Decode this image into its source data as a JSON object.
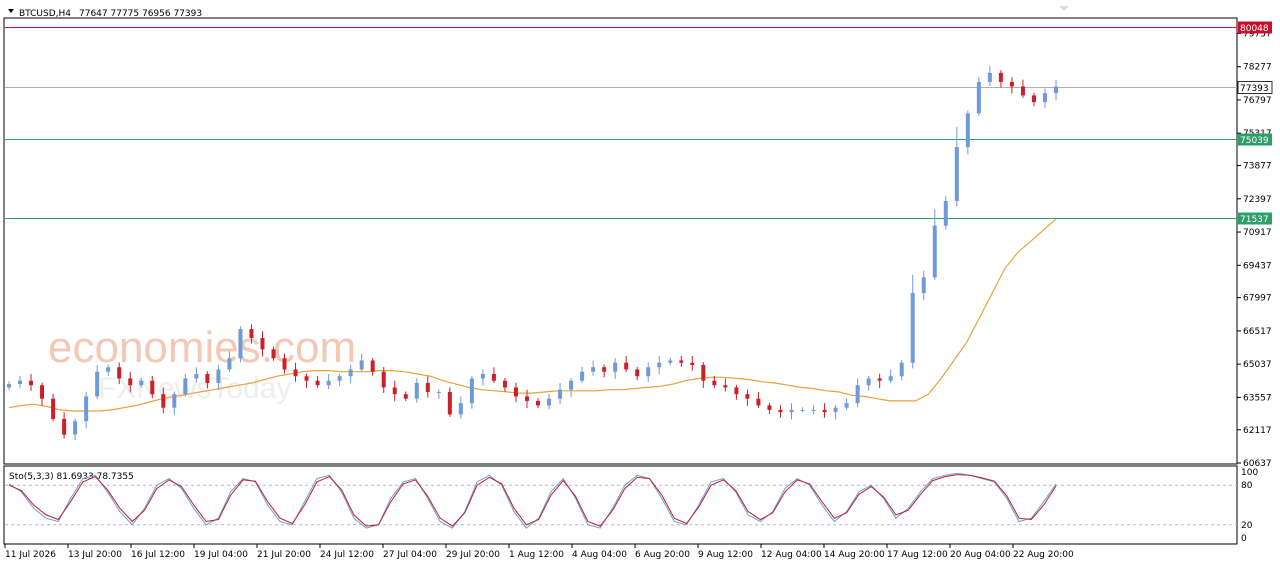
{
  "header": {
    "symbol": "BTCUSD,H4",
    "ohlc": "77647 77775 76956 77393"
  },
  "watermark": {
    "brand": "economies.com",
    "sub": "FXNewsToday"
  },
  "colors": {
    "bull": "#6f9ad8",
    "bear": "#cc1f28",
    "ma": "#e8a23c",
    "stoch_main": "#6ba0d8",
    "stoch_signal": "#c0202c",
    "res_line": "#c8102e",
    "green_line": "#2e9e6a",
    "price_line": "#b0b0b0"
  },
  "chart_data": [
    {
      "type": "candlestick",
      "title": "BTCUSD,H4",
      "y_ticks": [
        79757,
        78277,
        76797,
        75317,
        73877,
        72397,
        70917,
        69437,
        67997,
        66517,
        65037,
        63557,
        62117,
        60637
      ],
      "ylim": [
        60637,
        80400
      ],
      "x_ticks": [
        "11 Jul 2026",
        "13 Jul 20:00",
        "16 Jul 12:00",
        "19 Jul 04:00",
        "21 Jul 20:00",
        "24 Jul 12:00",
        "27 Jul 04:00",
        "29 Jul 20:00",
        "1 Aug 12:00",
        "4 Aug 04:00",
        "6 Aug 20:00",
        "9 Aug 12:00",
        "12 Aug 04:00",
        "14 Aug 20:00",
        "17 Aug 12:00",
        "20 Aug 04:00",
        "22 Aug 20:00"
      ],
      "levels": [
        {
          "label": "80048",
          "value": 80048,
          "kind": "resistance"
        },
        {
          "label": "77393",
          "value": 77393,
          "kind": "current"
        },
        {
          "label": "75039",
          "value": 75039,
          "kind": "support"
        },
        {
          "label": "71537",
          "value": 71537,
          "kind": "support"
        }
      ],
      "series": [
        {
          "name": "",
          "kind": "close",
          "values": [
            64150,
            64300,
            64100,
            63500,
            62600,
            61900,
            62500,
            63600,
            64700,
            64900,
            64400,
            64100,
            64300,
            63700,
            63100,
            63700,
            64400,
            64600,
            64200,
            64800,
            65300,
            66600,
            66200,
            65700,
            65300,
            64800,
            64500,
            64300,
            64100,
            64300,
            64500,
            64800,
            65200,
            64700,
            64000,
            63700,
            63500,
            64200,
            63800,
            63800,
            62800,
            63300,
            64400,
            64600,
            64300,
            64000,
            63600,
            63400,
            63200,
            63500,
            63900,
            64300,
            64700,
            64900,
            64700,
            65100,
            64800,
            64500,
            64900,
            65100,
            65200,
            65100,
            65000,
            64300,
            64100,
            64000,
            63700,
            63500,
            63200,
            63000,
            62900,
            63000,
            63000,
            63000,
            62900,
            63100,
            63300,
            64100,
            64400,
            64300,
            64500,
            65100,
            68200,
            68900,
            71200,
            72300,
            74700,
            76200,
            77600,
            78000,
            77600,
            77400,
            77000,
            76700,
            77100,
            77393
          ]
        },
        {
          "name": "",
          "kind": "moving-average",
          "values": [
            63100,
            63200,
            63250,
            63150,
            63000,
            62950,
            62950,
            62950,
            63000,
            63100,
            63200,
            63350,
            63500,
            63600,
            63700,
            63800,
            63900,
            64000,
            64100,
            64200,
            64350,
            64500,
            64600,
            64700,
            64750,
            64750,
            64700,
            64700,
            64700,
            64750,
            64750,
            64700,
            64600,
            64500,
            64300,
            64150,
            64000,
            63900,
            63850,
            63800,
            63750,
            63750,
            63800,
            63850,
            63850,
            63850,
            63850,
            63900,
            63900,
            63950,
            64000,
            64050,
            64150,
            64300,
            64400,
            64450,
            64450,
            64400,
            64350,
            64250,
            64200,
            64100,
            64000,
            63950,
            63850,
            63800,
            63650,
            63600,
            63500,
            63400,
            63400,
            63400,
            63700,
            64400,
            65200,
            66000,
            67100,
            68200,
            69300,
            70000,
            70500,
            71000,
            71500
          ]
        }
      ]
    },
    {
      "type": "line",
      "title": "Sto(5,3,3)",
      "readout": "Sto(5,3,3) 81.6933 78.7355",
      "y_ticks": [
        "100",
        "80",
        "20",
        "0"
      ],
      "levels": [
        80,
        20
      ],
      "series": [
        {
          "name": "",
          "values": [
            82,
            70,
            45,
            30,
            25,
            60,
            90,
            95,
            70,
            40,
            20,
            45,
            80,
            90,
            75,
            45,
            20,
            30,
            70,
            90,
            85,
            50,
            25,
            20,
            55,
            90,
            95,
            70,
            30,
            15,
            20,
            60,
            85,
            90,
            60,
            25,
            15,
            40,
            85,
            95,
            80,
            40,
            15,
            30,
            70,
            90,
            60,
            20,
            15,
            45,
            80,
            95,
            90,
            60,
            25,
            20,
            50,
            85,
            90,
            70,
            35,
            25,
            40,
            75,
            90,
            80,
            50,
            25,
            40,
            70,
            80,
            60,
            30,
            45,
            70,
            90,
            95,
            98,
            95,
            90,
            85,
            60,
            25,
            30,
            55,
            82
          ]
        },
        {
          "name": "",
          "values": [
            80,
            72,
            50,
            35,
            28,
            55,
            85,
            93,
            73,
            45,
            25,
            42,
            75,
            88,
            78,
            50,
            25,
            28,
            65,
            88,
            86,
            55,
            30,
            22,
            50,
            85,
            93,
            73,
            35,
            18,
            20,
            55,
            82,
            88,
            63,
            30,
            18,
            38,
            80,
            92,
            82,
            45,
            20,
            28,
            65,
            87,
            63,
            25,
            18,
            42,
            75,
            92,
            90,
            65,
            30,
            22,
            47,
            80,
            88,
            72,
            40,
            28,
            38,
            70,
            88,
            82,
            55,
            30,
            38,
            66,
            78,
            62,
            35,
            42,
            66,
            87,
            93,
            96,
            95,
            91,
            86,
            64,
            30,
            28,
            50,
            79
          ]
        }
      ]
    }
  ]
}
